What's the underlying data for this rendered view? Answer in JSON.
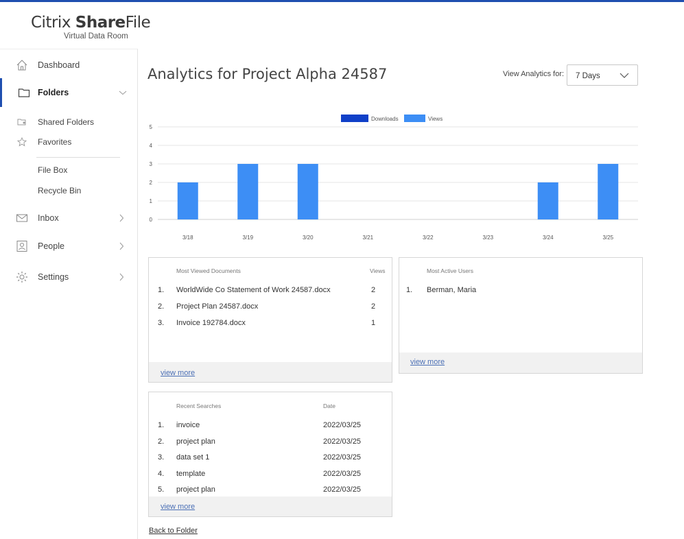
{
  "logo": {
    "prefix": "Citrix ",
    "bold": "Share",
    "suffix": "File",
    "subtitle": "Virtual Data Room"
  },
  "sidebar": {
    "dashboard": "Dashboard",
    "folders": "Folders",
    "shared_folders": "Shared Folders",
    "favorites": "Favorites",
    "file_box": "File Box",
    "recycle_bin": "Recycle Bin",
    "inbox": "Inbox",
    "people": "People",
    "settings": "Settings"
  },
  "header": {
    "title": "Analytics for Project Alpha 24587",
    "view_label": "View Analytics for:",
    "range_selected": "7 Days"
  },
  "colors": {
    "downloads": "#1040c8",
    "views": "#3d8ef5",
    "accent": "#1f4fb0",
    "link": "#4a6fb5"
  },
  "chart_data": {
    "type": "bar",
    "categories": [
      "3/18",
      "3/19",
      "3/20",
      "3/21",
      "3/22",
      "3/23",
      "3/24",
      "3/25"
    ],
    "series": [
      {
        "name": "Downloads",
        "values": [
          0,
          0,
          0,
          0,
          0,
          0,
          0,
          0
        ]
      },
      {
        "name": "Views",
        "values": [
          2,
          3,
          3,
          0,
          0,
          0,
          2,
          3
        ]
      }
    ],
    "y_ticks": [
      "0",
      "1",
      "2",
      "3",
      "4",
      "5"
    ],
    "ylim": [
      0,
      5
    ],
    "grid": true,
    "legend": "top-center"
  },
  "most_viewed": {
    "title": "Most Viewed Documents",
    "col_views": "Views",
    "rows": [
      {
        "num": "1.",
        "name": "WorldWide Co Statement of Work 24587.docx",
        "views": "2"
      },
      {
        "num": "2.",
        "name": "Project Plan 24587.docx",
        "views": "2"
      },
      {
        "num": "3.",
        "name": "Invoice 192784.docx",
        "views": "1"
      }
    ],
    "view_more": "view more"
  },
  "most_active": {
    "title": "Most Active Users",
    "rows": [
      {
        "num": "1.",
        "name": "Berman, Maria"
      }
    ],
    "view_more": "view more"
  },
  "recent_searches": {
    "title": "Recent Searches",
    "col_date": "Date",
    "rows": [
      {
        "num": "1.",
        "term": "invoice",
        "date": "2022/03/25"
      },
      {
        "num": "2.",
        "term": "project plan",
        "date": "2022/03/25"
      },
      {
        "num": "3.",
        "term": "data set 1",
        "date": "2022/03/25"
      },
      {
        "num": "4.",
        "term": "template",
        "date": "2022/03/25"
      },
      {
        "num": "5.",
        "term": "project plan",
        "date": "2022/03/25"
      }
    ],
    "view_more": "view more"
  },
  "back_link": "Back to Folder"
}
